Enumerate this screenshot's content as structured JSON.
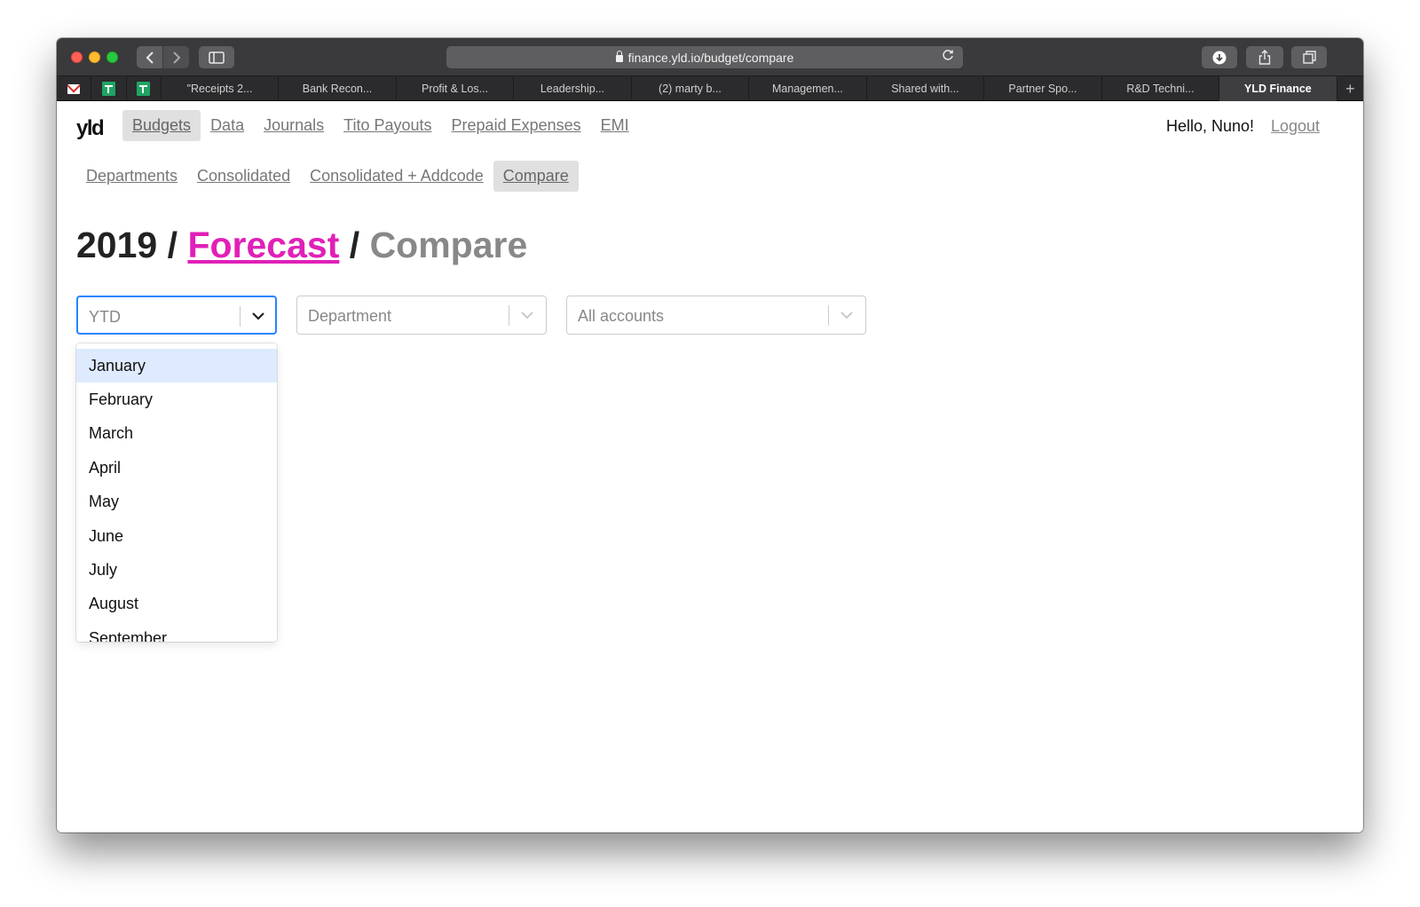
{
  "browser": {
    "url": "finance.yld.io/budget/compare",
    "tabs": [
      {
        "label": "\"Receipts 2...",
        "active": false
      },
      {
        "label": "Bank Recon...",
        "active": false
      },
      {
        "label": "Profit & Los...",
        "active": false
      },
      {
        "label": "Leadership...",
        "active": false
      },
      {
        "label": "(2) marty b...",
        "active": false
      },
      {
        "label": "Managemen...",
        "active": false
      },
      {
        "label": "Shared with...",
        "active": false
      },
      {
        "label": "Partner Spo...",
        "active": false
      },
      {
        "label": "R&D Techni...",
        "active": false
      },
      {
        "label": "YLD Finance",
        "active": true
      }
    ],
    "pinned_icons": [
      "gmail-icon",
      "google-sheets-icon",
      "google-sheets-icon"
    ]
  },
  "app": {
    "logo": "yld",
    "main_nav": [
      {
        "label": "Budgets",
        "active": true
      },
      {
        "label": "Data",
        "active": false
      },
      {
        "label": "Journals",
        "active": false
      },
      {
        "label": "Tito Payouts",
        "active": false
      },
      {
        "label": "Prepaid Expenses",
        "active": false
      },
      {
        "label": "EMI",
        "active": false
      }
    ],
    "greeting": "Hello, Nuno!",
    "logout": "Logout",
    "sub_nav": [
      {
        "label": "Departments",
        "active": false
      },
      {
        "label": "Consolidated",
        "active": false
      },
      {
        "label": "Consolidated + Addcode",
        "active": false
      },
      {
        "label": "Compare",
        "active": true
      }
    ]
  },
  "breadcrumb": {
    "year": "2019",
    "link": "Forecast",
    "current": "Compare",
    "separator": "/"
  },
  "filters": {
    "period": {
      "value": "YTD",
      "open": true
    },
    "department": {
      "placeholder": "Department"
    },
    "accounts": {
      "value": "All accounts"
    }
  },
  "period_options": [
    "January",
    "February",
    "March",
    "April",
    "May",
    "June",
    "July",
    "August",
    "September"
  ],
  "highlighted_option": "January",
  "colors": {
    "accent_link": "#e020b8",
    "focus_border": "#2684ff",
    "option_highlight": "#deebff"
  }
}
